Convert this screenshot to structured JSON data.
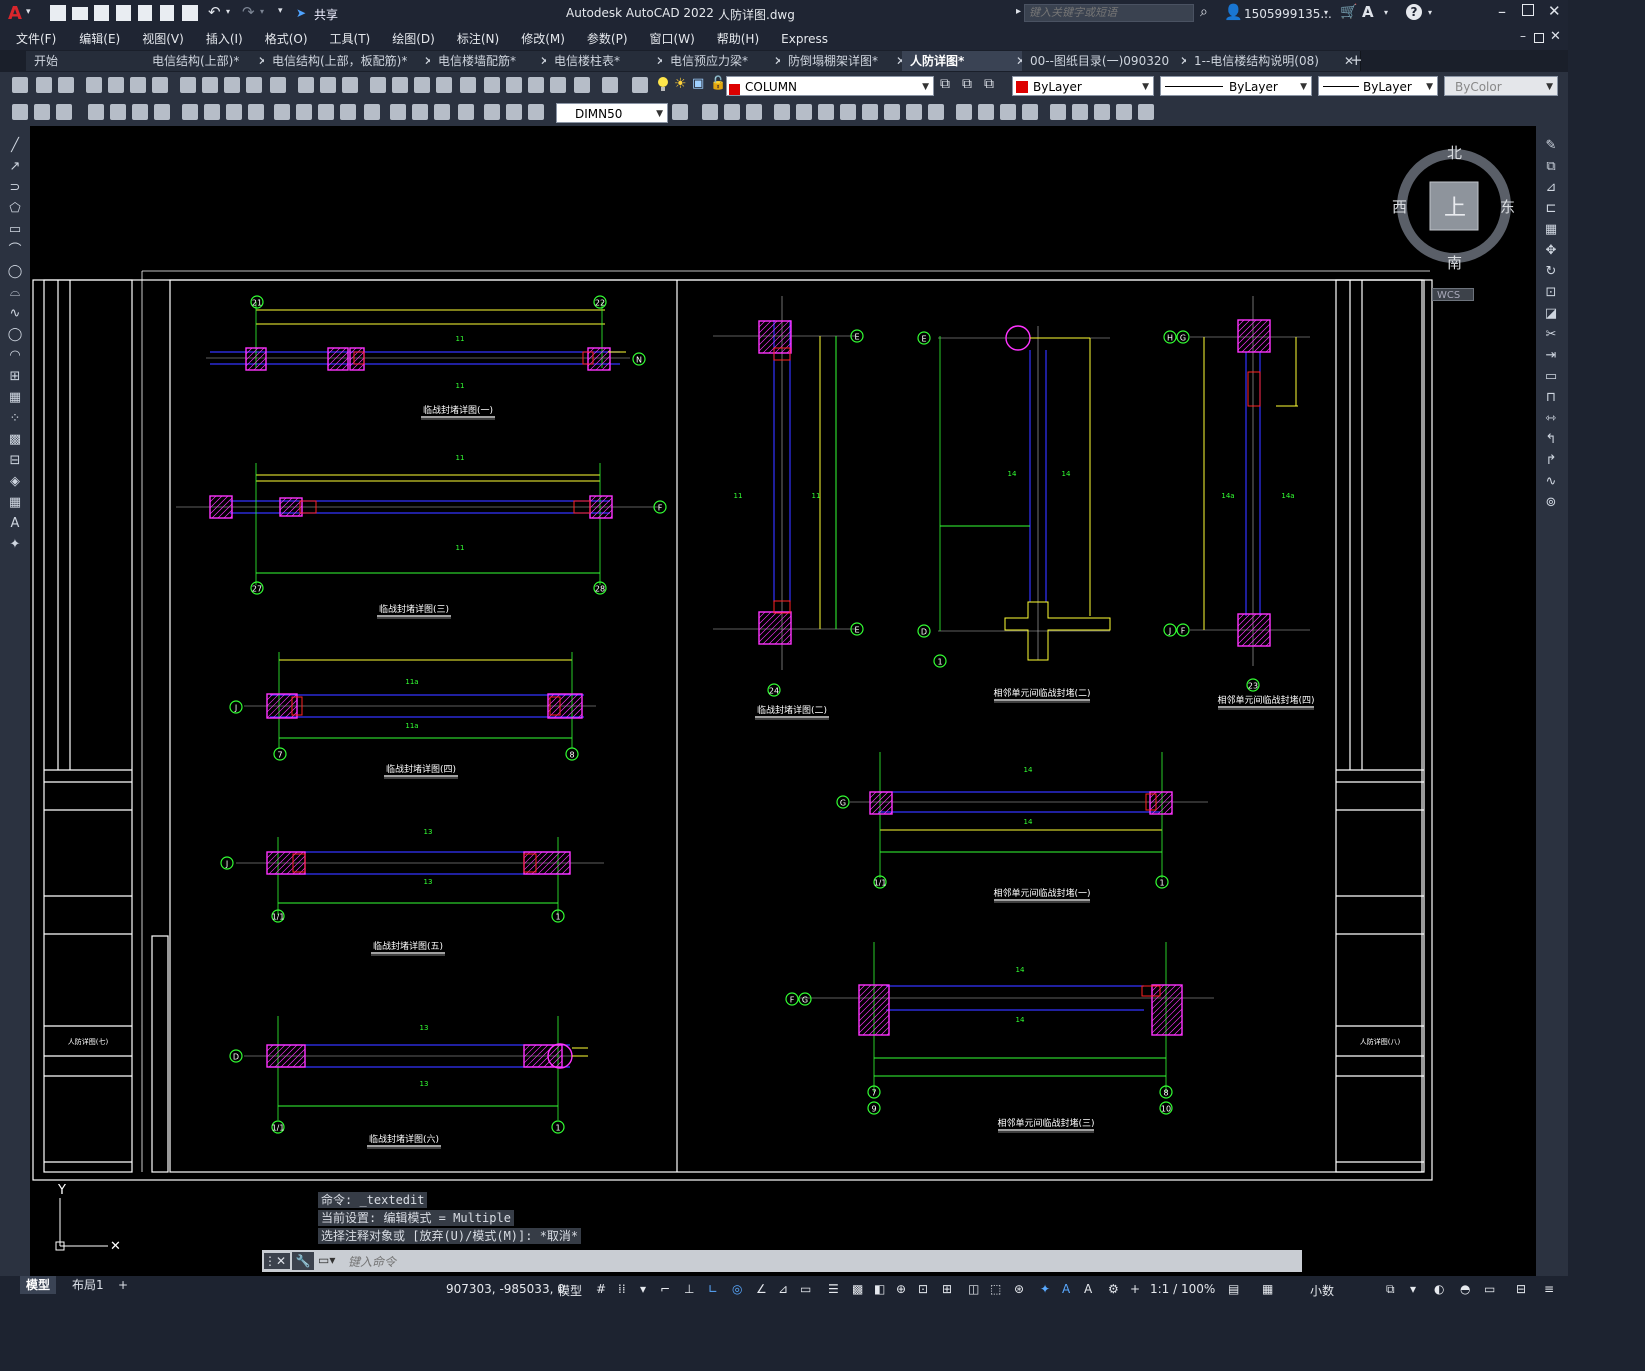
{
  "app": {
    "title": "Autodesk AutoCAD 2022",
    "document": "人防详图.dwg",
    "logo": "A",
    "share_label": "共享",
    "search_placeholder": "键入关键字或短语",
    "user": "1505999135...",
    "help": "?"
  },
  "menu": [
    "文件(F)",
    "编辑(E)",
    "视图(V)",
    "插入(I)",
    "格式(O)",
    "工具(T)",
    "绘图(D)",
    "标注(N)",
    "修改(M)",
    "参数(P)",
    "窗口(W)",
    "帮助(H)",
    "Express"
  ],
  "tabs": [
    {
      "label": "开始",
      "close": false
    },
    {
      "label": "电信结构(上部)*",
      "close": true
    },
    {
      "label": "电信结构(上部，板配筋)*",
      "close": true
    },
    {
      "label": "电信楼墙配筋*",
      "close": true
    },
    {
      "label": "电信楼柱表*",
      "close": true
    },
    {
      "label": "电信预应力梁*",
      "close": true
    },
    {
      "label": "防倒塌棚架详图*",
      "close": true
    },
    {
      "label": "人防详图*",
      "close": true,
      "active": true
    },
    {
      "label": "00--图纸目录(一)090320",
      "close": true
    },
    {
      "label": "1--电信楼结构说明(08)",
      "close": true
    }
  ],
  "properties": {
    "layer": "COLUMN",
    "color": "ByLayer",
    "linetype": "ByLayer",
    "lineweight": "ByLayer",
    "plotstyle": "ByColor",
    "dimstyle": "DIMN50",
    "layer_color": "#ffff00",
    "color_swatch": "#dd0000"
  },
  "viewcube": {
    "north": "北",
    "south": "南",
    "east": "东",
    "west": "西",
    "top": "上",
    "wcs": "WCS"
  },
  "command": {
    "history": [
      "命令: _textedit",
      "当前设置: 编辑模式 = Multiple",
      "选择注释对象或 [放弃(U)/模式(M)]: *取消*"
    ],
    "placeholder": "键入命令"
  },
  "layouts": [
    "模型",
    "布局1",
    "+"
  ],
  "status": {
    "coords": "907303, -985033, 0",
    "model": "模型",
    "scale": "1:1 / 100%",
    "units": "小数"
  },
  "drawing": {
    "details": [
      "临战封堵详图(一)",
      "临战封堵详图(三)",
      "临战封堵详图(四)",
      "临战封堵详图(五)",
      "临战封堵详图(六)",
      "临战封堵详图(二)",
      "相邻单元间临战封堵(二)",
      "相邻单元间临战封堵(四)",
      "相邻单元间临战封堵(一)",
      "相邻单元间临战封堵(三)"
    ],
    "axes_left": [
      "21",
      "22",
      "N",
      "F",
      "27",
      "28",
      "J",
      "7",
      "8",
      "J",
      "1/1",
      "1",
      "D",
      "1/1",
      "1"
    ],
    "axes_right": [
      "E",
      "E",
      "24",
      "E",
      "D",
      "1",
      "H",
      "G",
      "J",
      "F",
      "23",
      "G",
      "1/1",
      "1",
      "F",
      "G",
      "7",
      "9",
      "8",
      "10"
    ],
    "wall_labels": [
      "11",
      "11",
      "11",
      "11",
      "11a",
      "11a",
      "13",
      "13",
      "13",
      "13",
      "11",
      "11",
      "14",
      "14",
      "14a",
      "14a",
      "14",
      "14",
      "14",
      "14"
    ],
    "sheet_left": "人防详图(七)",
    "sheet_right": "人防详图(八)"
  }
}
